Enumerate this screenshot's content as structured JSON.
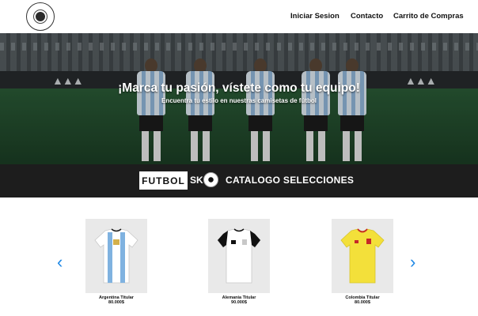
{
  "header": {
    "logo": "club-crest",
    "nav": [
      {
        "label": "Iniciar Sesion"
      },
      {
        "label": "Contacto"
      },
      {
        "label": "Carrito de Compras"
      }
    ]
  },
  "hero": {
    "title": "¡Marca tu pasión, vístete como tu equipo!",
    "subtitle": "Encuentra tu estilo en nuestras camisetas de fútbol"
  },
  "category_bar": {
    "brand_box": "FUTBOL",
    "brand_suffix": "SK",
    "title": "CATALOGO SELECCIONES"
  },
  "carousel": {
    "prev_icon": "chevron-left-icon",
    "next_icon": "chevron-right-icon",
    "products": [
      {
        "name": "Argentina Titular",
        "price": "80.000$",
        "colors": {
          "main": "#ffffff",
          "stripe": "#7fb2e0",
          "trim": "#1c1c1c"
        }
      },
      {
        "name": "Alemania Titular",
        "price": "90.000$",
        "colors": {
          "main": "#ffffff",
          "stripe": "#ffffff",
          "trim": "#111111"
        }
      },
      {
        "name": "Colombia Titular",
        "price": "80.000$",
        "colors": {
          "main": "#f3e03a",
          "stripe": "#f3e03a",
          "trim": "#c62828"
        }
      }
    ]
  },
  "colors": {
    "accent": "#1e88e5",
    "dark_bar": "#1d1d1d"
  }
}
